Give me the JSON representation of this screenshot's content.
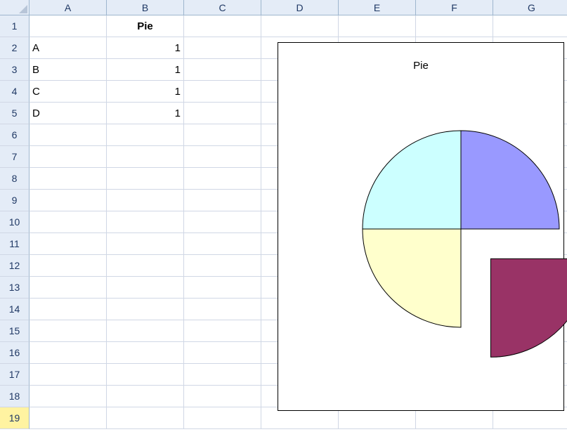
{
  "columns": [
    "A",
    "B",
    "C",
    "D",
    "E",
    "F",
    "G"
  ],
  "rows": [
    "1",
    "2",
    "3",
    "4",
    "5",
    "6",
    "7",
    "8",
    "9",
    "10",
    "11",
    "12",
    "13",
    "14",
    "15",
    "16",
    "17",
    "18",
    "19"
  ],
  "selected_row_index": 18,
  "header_cell": {
    "row": 0,
    "col": 1,
    "label": "Pie"
  },
  "data_rows": [
    {
      "label": "A",
      "value": "1"
    },
    {
      "label": "B",
      "value": "1"
    },
    {
      "label": "C",
      "value": "1"
    },
    {
      "label": "D",
      "value": "1"
    }
  ],
  "chart_data": {
    "type": "pie",
    "title": "Pie",
    "categories": [
      "A",
      "B",
      "C",
      "D"
    ],
    "values": [
      1,
      1,
      1,
      1
    ],
    "slice_colors": [
      "#9999ff",
      "#993366",
      "#ffffcc",
      "#ccffff"
    ],
    "exploded_slice_index": 1
  }
}
